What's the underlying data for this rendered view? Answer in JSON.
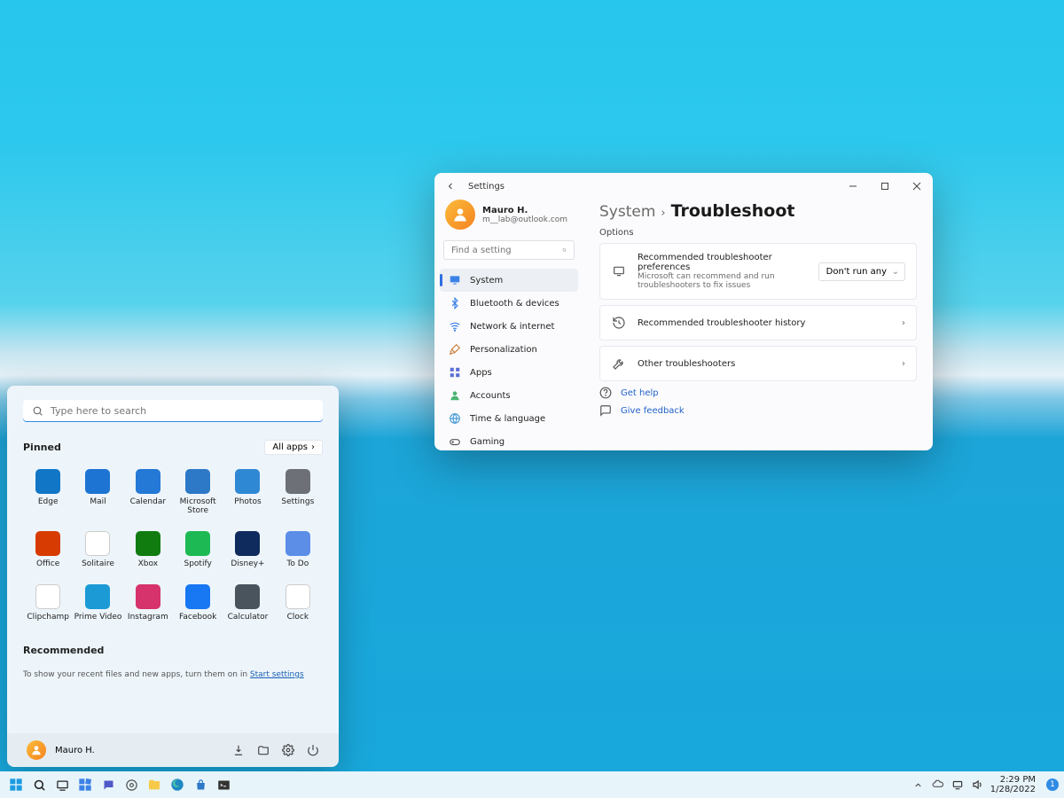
{
  "settings": {
    "window_title": "Settings",
    "user": {
      "name": "Mauro H.",
      "email": "m__lab@outlook.com"
    },
    "search_placeholder": "Find a setting",
    "nav": [
      {
        "label": "System",
        "icon": "monitor",
        "active": true
      },
      {
        "label": "Bluetooth & devices",
        "icon": "bluetooth"
      },
      {
        "label": "Network & internet",
        "icon": "wifi"
      },
      {
        "label": "Personalization",
        "icon": "brush"
      },
      {
        "label": "Apps",
        "icon": "apps"
      },
      {
        "label": "Accounts",
        "icon": "person"
      },
      {
        "label": "Time & language",
        "icon": "globe"
      },
      {
        "label": "Gaming",
        "icon": "gaming"
      }
    ],
    "breadcrumb": {
      "parent": "System",
      "current": "Troubleshoot"
    },
    "options_label": "Options",
    "cards": [
      {
        "icon": "troubleshooter",
        "title": "Recommended troubleshooter preferences",
        "subtitle": "Microsoft can recommend and run troubleshooters to fix issues",
        "control": "select",
        "control_value": "Don't run any"
      },
      {
        "icon": "history",
        "title": "Recommended troubleshooter history",
        "control": "chevron"
      },
      {
        "icon": "wrench",
        "title": "Other troubleshooters",
        "control": "chevron"
      }
    ],
    "help": {
      "get_help": "Get help",
      "feedback": "Give feedback"
    }
  },
  "start": {
    "search_placeholder": "Type here to search",
    "pinned_label": "Pinned",
    "all_apps_label": "All apps",
    "recommended_label": "Recommended",
    "recommended_tip_prefix": "To show your recent files and new apps, turn them on in ",
    "recommended_tip_link": "Start settings",
    "apps": [
      {
        "label": "Edge",
        "bg": "#1176c6"
      },
      {
        "label": "Mail",
        "bg": "#1e74d2"
      },
      {
        "label": "Calendar",
        "bg": "#2478d6"
      },
      {
        "label": "Microsoft Store",
        "bg": "#2d79c7"
      },
      {
        "label": "Photos",
        "bg": "#2f88d4"
      },
      {
        "label": "Settings",
        "bg": "#6d7077"
      },
      {
        "label": "Office",
        "bg": "#d83b01"
      },
      {
        "label": "Solitaire",
        "bg": "#ffffff"
      },
      {
        "label": "Xbox",
        "bg": "#107c10"
      },
      {
        "label": "Spotify",
        "bg": "#1db954"
      },
      {
        "label": "Disney+",
        "bg": "#0f2a5c"
      },
      {
        "label": "To Do",
        "bg": "#5c8ee8"
      },
      {
        "label": "Clipchamp",
        "bg": "#ffffff"
      },
      {
        "label": "Prime Video",
        "bg": "#1b9ad6"
      },
      {
        "label": "Instagram",
        "bg": "#d6326b"
      },
      {
        "label": "Facebook",
        "bg": "#1877f2"
      },
      {
        "label": "Calculator",
        "bg": "#4a545d"
      },
      {
        "label": "Clock",
        "bg": "#ffffff"
      }
    ],
    "user_name": "Mauro H."
  },
  "taskbar": {
    "time": "2:29 PM",
    "date": "1/28/2022",
    "notif_count": "1"
  }
}
